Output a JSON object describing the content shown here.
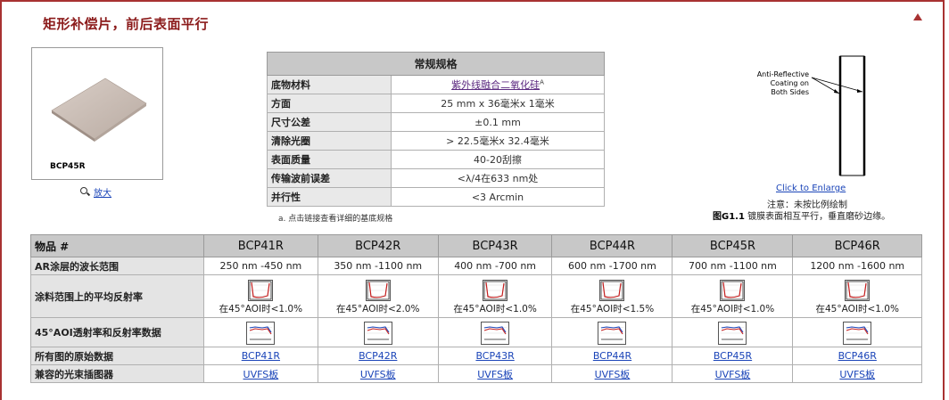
{
  "header": {
    "title": "矩形补偿片，前后表面平行"
  },
  "product_image": {
    "caption": "BCP45R",
    "enlarge_label": "放大"
  },
  "spec_table": {
    "title": "常规规格",
    "rows": [
      {
        "label": "底物材料",
        "value": "紫外线融合二氧化硅",
        "sup": "A"
      },
      {
        "label": "方面",
        "value": "25 mm x 36毫米x 1毫米"
      },
      {
        "label": "尺寸公差",
        "value": "±0.1 mm"
      },
      {
        "label": "清除光圈",
        "value": "> 22.5毫米x 32.4毫米"
      },
      {
        "label": "表面质量",
        "value": "40-20刮擦"
      },
      {
        "label": "传输波前误差",
        "value": "<λ/4在633 nm处"
      },
      {
        "label": "并行性",
        "value": "<3 Arcmin"
      }
    ],
    "footnote": "a. 点击链接查看详细的基底规格"
  },
  "diagram": {
    "label_lines": [
      "Anti-Reflective",
      "Coating on",
      "Both Sides"
    ],
    "enlarge_link": "Click to Enlarge",
    "note": "注意：未按比例绘制",
    "figure_id": "图G1.1",
    "figure_caption": " 镀膜表面相互平行，垂直磨砂边缘。"
  },
  "item_table": {
    "header_label": "物品 #",
    "items": [
      "BCP41R",
      "BCP42R",
      "BCP43R",
      "BCP44R",
      "BCP45R",
      "BCP46R"
    ],
    "row_labels": {
      "wavelength": "AR涂层的波长范围",
      "reflectance": "涂料范围上的平均反射率",
      "data": "45°AOI透射率和反射率数据",
      "raw": "所有图的原始数据",
      "mount": "兼容的光束插图器"
    },
    "wavelength": [
      "250 nm -450 nm",
      "350 nm -1100 nm",
      "400 nm -700 nm",
      "600 nm -1700 nm",
      "700 nm -1100 nm",
      "1200 nm -1600 nm"
    ],
    "reflectance": [
      "在45°AOI时<1.0%",
      "在45°AOI时<2.0%",
      "在45°AOI时<1.0%",
      "在45°AOI时<1.5%",
      "在45°AOI时<1.0%",
      "在45°AOI时<1.0%"
    ],
    "raw": [
      "BCP41R",
      "BCP42R",
      "BCP43R",
      "BCP44R",
      "BCP45R",
      "BCP46R"
    ],
    "mount": [
      "UVFS板",
      "UVFS板",
      "UVFS板",
      "UVFS板",
      "UVFS板",
      "UVFS板"
    ]
  },
  "colors": {
    "accent": "#a83232",
    "title": "#8b1a1a",
    "link": "#1a44b8",
    "header_bg": "#c8c8c8"
  },
  "icons": {
    "back_to_top": "triangle-up-icon",
    "enlarge": "magnifier-icon",
    "reflectance_plot": "reflectance-graph-icon",
    "transmission_plot": "transmission-graph-icon"
  }
}
